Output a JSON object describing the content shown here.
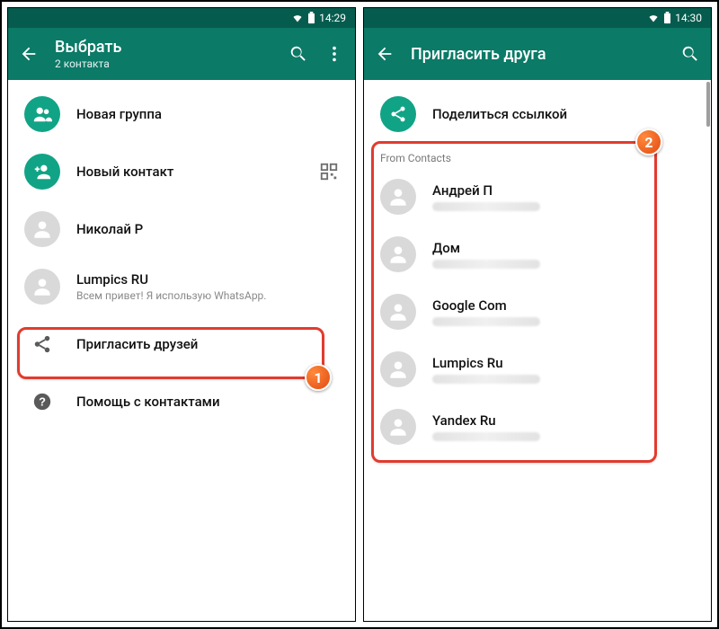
{
  "left": {
    "statusbar": {
      "time": "14:29"
    },
    "appbar": {
      "title": "Выбрать",
      "subtitle": "2 контакта"
    },
    "rows": {
      "new_group": "Новая группа",
      "new_contact": "Новый контакт",
      "contact1": "Николай Р",
      "contact2_name": "Lumpics RU",
      "contact2_status": "Всем привет! Я использую WhatsApp.",
      "invite": "Пригласить друзей",
      "help": "Помощь с контактами"
    },
    "badge": "1"
  },
  "right": {
    "statusbar": {
      "time": "14:30"
    },
    "appbar": {
      "title": "Пригласить друга"
    },
    "share_link": "Поделиться ссылкой",
    "section": "From Contacts",
    "contacts": [
      {
        "name": "Андрей П"
      },
      {
        "name": "Дом"
      },
      {
        "name": "Google Com"
      },
      {
        "name": "Lumpics Ru"
      },
      {
        "name": "Yandex Ru"
      }
    ],
    "badge": "2"
  }
}
